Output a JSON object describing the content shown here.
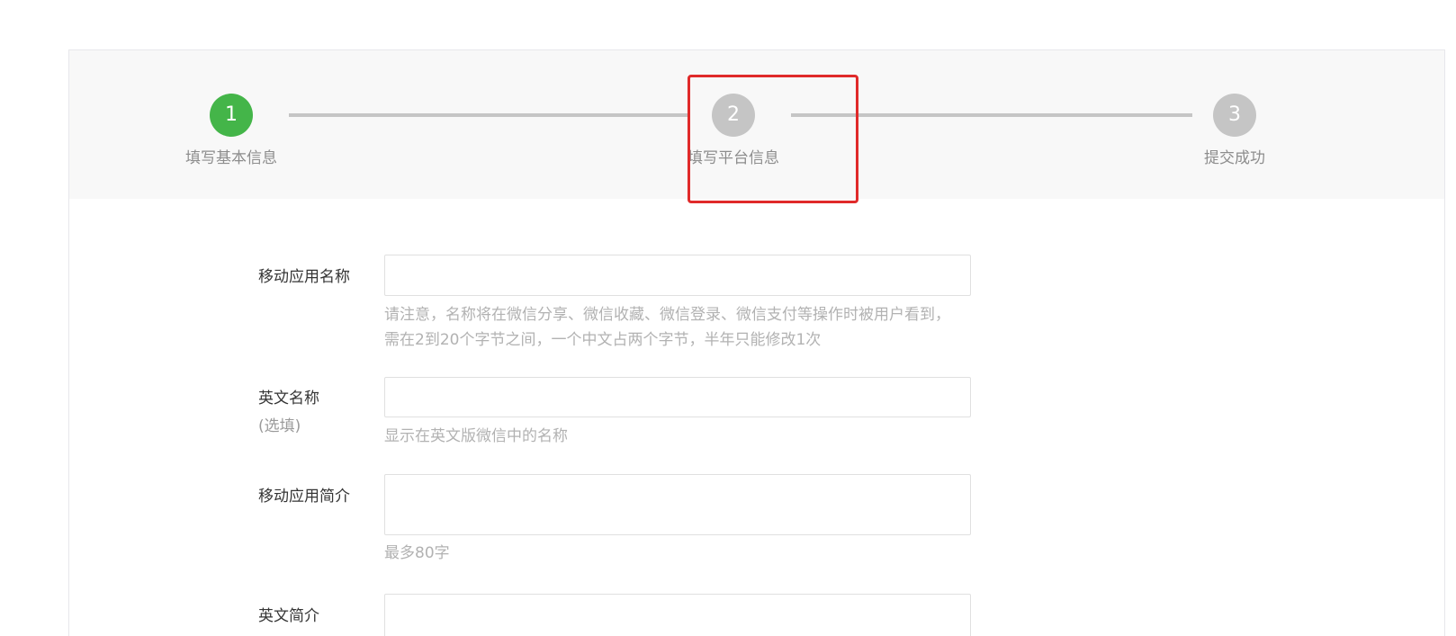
{
  "steps": [
    {
      "number": "1",
      "label": "填写基本信息",
      "status": "done"
    },
    {
      "number": "2",
      "label": "填写平台信息",
      "status": "current"
    },
    {
      "number": "3",
      "label": "提交成功",
      "status": "pending"
    }
  ],
  "colors": {
    "done": "#44b549",
    "pending": "#c5c5c5",
    "highlight": "#e02a2a"
  },
  "form": {
    "app_name": {
      "label": "移动应用名称",
      "value": "",
      "tip_line1": "请注意，名称将在微信分享、微信收藏、微信登录、微信支付等操作时被用户看到，",
      "tip_line2": "需在2到20个字节之间，一个中文占两个字节，半年只能修改1次"
    },
    "english_name": {
      "label": "英文名称",
      "optional": "(选填)",
      "value": "",
      "tip": "显示在英文版微信中的名称"
    },
    "app_intro": {
      "label": "移动应用简介",
      "value": "",
      "tip": "最多80字"
    },
    "english_intro": {
      "label": "英文简介",
      "value": ""
    }
  }
}
